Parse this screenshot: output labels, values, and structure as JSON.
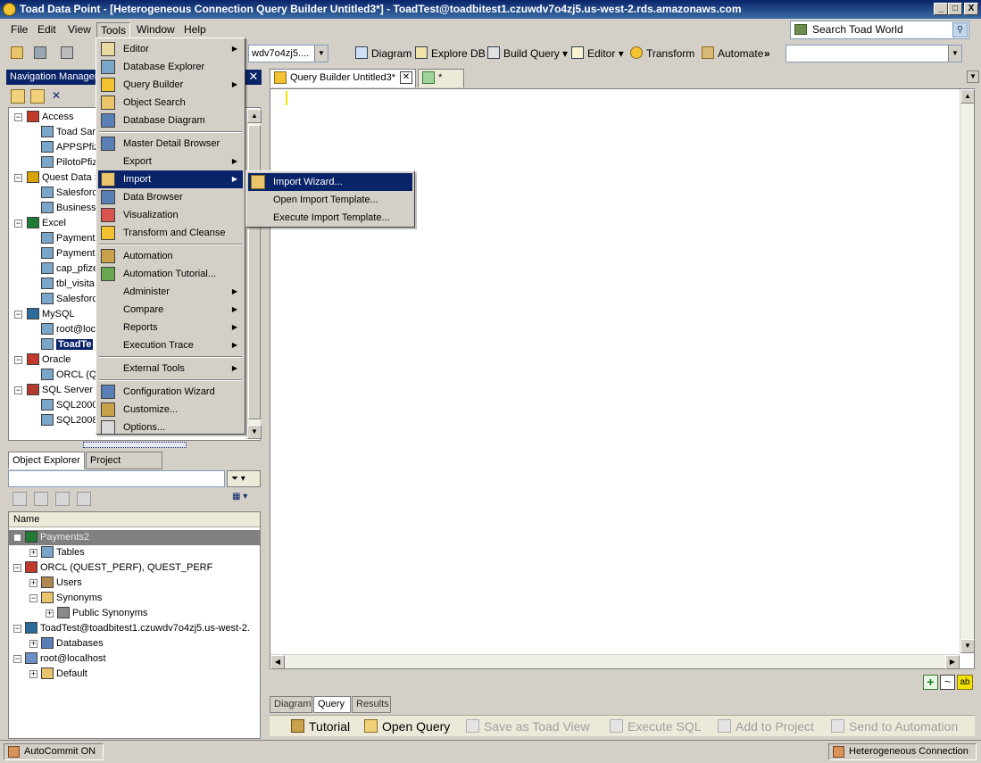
{
  "window": {
    "title": "Toad Data Point - [Heterogeneous Connection Query Builder Untitled3*] - ToadTest@toadbitest1.czuwdv7o4zj5.us-west-2.rds.amazonaws.com",
    "controls": [
      "_",
      "□",
      "X"
    ]
  },
  "menubar": [
    "File",
    "Edit",
    "View",
    "Tools",
    "Window",
    "Help"
  ],
  "search": {
    "placeholder": "Search Toad World"
  },
  "toolbar": {
    "connection_combo": "wdv7o4zj5....",
    "buttons": [
      "Diagram",
      "Explore DB",
      "Build Query",
      "Editor",
      "Transform",
      "Automate"
    ],
    "chevron": "»"
  },
  "nav_manager": {
    "title": "Navigation Manager",
    "close": "✕",
    "tree": [
      {
        "label": "Access",
        "level": 0,
        "icon": "access-icon"
      },
      {
        "label": "Toad Sar",
        "level": 1
      },
      {
        "label": "APPSPfiz",
        "level": 1
      },
      {
        "label": "PilotoPfiz",
        "level": 1
      },
      {
        "label": "Quest Data S",
        "level": 0,
        "icon": "quest-data-icon"
      },
      {
        "label": "Salesforc",
        "level": 1
      },
      {
        "label": "Business",
        "level": 1
      },
      {
        "label": "Excel",
        "level": 0,
        "icon": "excel-icon"
      },
      {
        "label": "Payment",
        "level": 1
      },
      {
        "label": "Payment",
        "level": 1
      },
      {
        "label": "cap_pfize",
        "level": 1
      },
      {
        "label": "tbl_visita",
        "level": 1
      },
      {
        "label": "Salesforc",
        "level": 1
      },
      {
        "label": "MySQL",
        "level": 0,
        "icon": "mysql-icon"
      },
      {
        "label": "root@loca",
        "level": 1
      },
      {
        "label": "ToadTe",
        "level": 1,
        "selected": true
      },
      {
        "label": "Oracle",
        "level": 0,
        "icon": "oracle-icon"
      },
      {
        "label": "ORCL (Q",
        "level": 1
      },
      {
        "label": "SQL Server",
        "level": 0,
        "icon": "sqlserver-icon"
      },
      {
        "label": "SQL2000",
        "level": 1
      },
      {
        "label": "SQL2008",
        "level": 1
      }
    ]
  },
  "left_tabs": [
    "Object Explorer",
    "Project Manager"
  ],
  "object_explorer": {
    "column": "Name",
    "tree": [
      {
        "label": "Payments2",
        "level": 0
      },
      {
        "label": "Tables",
        "level": 1
      },
      {
        "label": "ORCL (QUEST_PERF), QUEST_PERF",
        "level": 0
      },
      {
        "label": "Users",
        "level": 1
      },
      {
        "label": "Synonyms",
        "level": 1
      },
      {
        "label": "Public Synonyms",
        "level": 2
      },
      {
        "label": "ToadTest@toadbitest1.czuwdv7o4zj5.us-west-2.",
        "level": 0
      },
      {
        "label": "Databases",
        "level": 1
      },
      {
        "label": "root@localhost",
        "level": 0
      },
      {
        "label": "Default",
        "level": 1
      }
    ]
  },
  "doc_tabs": [
    {
      "label": "Query Builder Untitled3*"
    },
    {
      "label": "*"
    }
  ],
  "qb_tabs": [
    "Diagram",
    "Query",
    "Results"
  ],
  "qb_toolbar": [
    {
      "label": "Tutorial",
      "enabled": true
    },
    {
      "label": "Open Query",
      "enabled": true
    },
    {
      "label": "Save as Toad View",
      "enabled": false
    },
    {
      "label": "Execute SQL",
      "enabled": false
    },
    {
      "label": "Add to Project",
      "enabled": false
    },
    {
      "label": "Send to Automation",
      "enabled": false
    }
  ],
  "statusbar": {
    "autocommit": "AutoCommit ON ▾",
    "connection": "Heterogeneous Connection ▾"
  },
  "tools_menu": [
    {
      "label": "Editor",
      "submenu": true
    },
    {
      "label": "Database Explorer"
    },
    {
      "label": "Query Builder",
      "submenu": true
    },
    {
      "label": "Object Search"
    },
    {
      "label": "Database Diagram"
    },
    {
      "sep": true
    },
    {
      "label": "Master Detail Browser"
    },
    {
      "label": "Export",
      "submenu": true
    },
    {
      "label": "Import",
      "submenu": true,
      "highlighted": true
    },
    {
      "label": "Data Browser"
    },
    {
      "label": "Visualization"
    },
    {
      "label": "Transform and Cleanse"
    },
    {
      "sep": true
    },
    {
      "label": "Automation"
    },
    {
      "label": "Automation Tutorial..."
    },
    {
      "label": "Administer",
      "submenu": true
    },
    {
      "label": "Compare",
      "submenu": true
    },
    {
      "label": "Reports",
      "submenu": true
    },
    {
      "label": "Execution Trace",
      "submenu": true
    },
    {
      "sep": true
    },
    {
      "label": "External Tools",
      "submenu": true
    },
    {
      "sep": true
    },
    {
      "label": "Configuration Wizard"
    },
    {
      "label": "Customize..."
    },
    {
      "label": "Options..."
    }
  ],
  "import_submenu": [
    {
      "label": "Import Wizard...",
      "highlighted": true
    },
    {
      "label": "Open Import Template..."
    },
    {
      "label": "Execute Import Template..."
    }
  ],
  "colors": {
    "accent": "#0a246a",
    "window_bg": "#d4d0c8"
  }
}
